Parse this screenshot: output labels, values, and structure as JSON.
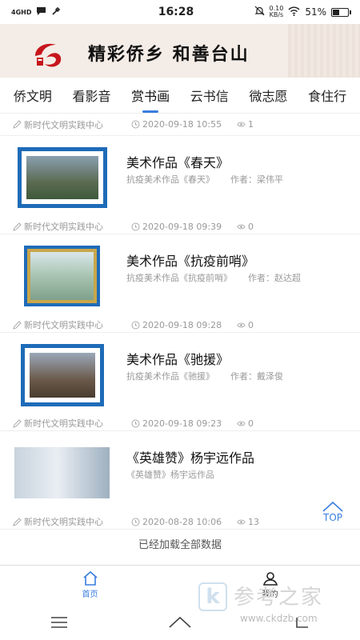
{
  "status_bar": {
    "network": "4GHD",
    "time": "16:28",
    "speed_value": "0.10",
    "speed_unit": "KB/s",
    "battery": "51%",
    "battery_level": 0.51
  },
  "banner": {
    "slogan": "精彩侨乡 和善台山"
  },
  "tabs": [
    {
      "label": "侨文明",
      "active": false
    },
    {
      "label": "看影音",
      "active": false
    },
    {
      "label": "赏书画",
      "active": true
    },
    {
      "label": "云书信",
      "active": false
    },
    {
      "label": "微志愿",
      "active": false
    },
    {
      "label": "食住行",
      "active": false
    }
  ],
  "first_meta": {
    "source": "新时代文明实践中心",
    "date": "2020-09-18 10:55",
    "views": "1"
  },
  "items": [
    {
      "title": "美术作品《春天》",
      "subtitle": "抗疫美术作品《春天》",
      "author": "作者：梁伟平",
      "source": "新时代文明实践中心",
      "date": "2020-09-18 09:39",
      "views": "0"
    },
    {
      "title": "美术作品《抗疫前哨》",
      "subtitle": "抗疫美术作品《抗疫前哨》",
      "author": "作者：赵达超",
      "source": "新时代文明实践中心",
      "date": "2020-09-18 09:28",
      "views": "0"
    },
    {
      "title": "美术作品《驰援》",
      "subtitle": "抗疫美术作品《驰援》",
      "author": "作者：戴泽俊",
      "source": "新时代文明实践中心",
      "date": "2020-09-18 09:23",
      "views": "0"
    },
    {
      "title": "《英雄赞》杨宇远作品",
      "subtitle": "《英雄赞》杨宇远作品",
      "author": "",
      "source": "新时代文明实践中心",
      "date": "2020-08-28 10:06",
      "views": "13"
    }
  ],
  "load_all": "已经加载全部数据",
  "top_button": "TOP",
  "bottom_nav": {
    "home": "首页",
    "mine": "我的"
  },
  "watermark": {
    "text": "参考之家",
    "url": "www.ckdzb.com"
  },
  "colors": {
    "accent": "#3a7de0",
    "frame_blue": "#1e6bb8"
  }
}
